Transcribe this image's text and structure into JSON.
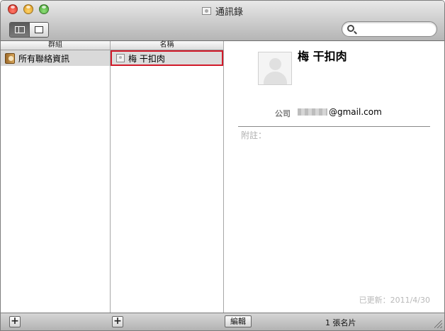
{
  "window": {
    "title": "通訊錄"
  },
  "toolbar": {
    "search": {
      "value": "",
      "placeholder": ""
    }
  },
  "groups": {
    "header": "群組",
    "items": [
      {
        "label": "所有聯絡資訊"
      }
    ]
  },
  "names": {
    "header": "名稱",
    "items": [
      {
        "label": "梅 干扣肉"
      }
    ]
  },
  "card": {
    "name": "梅 干扣肉",
    "company_label": "公司",
    "email_suffix": "@gmail.com",
    "note_label": "附註：",
    "updated": "已更新：2011/4/30"
  },
  "footer": {
    "add_group": "+",
    "add_contact": "+",
    "edit_label": "編輯",
    "count": "1 張名片"
  }
}
